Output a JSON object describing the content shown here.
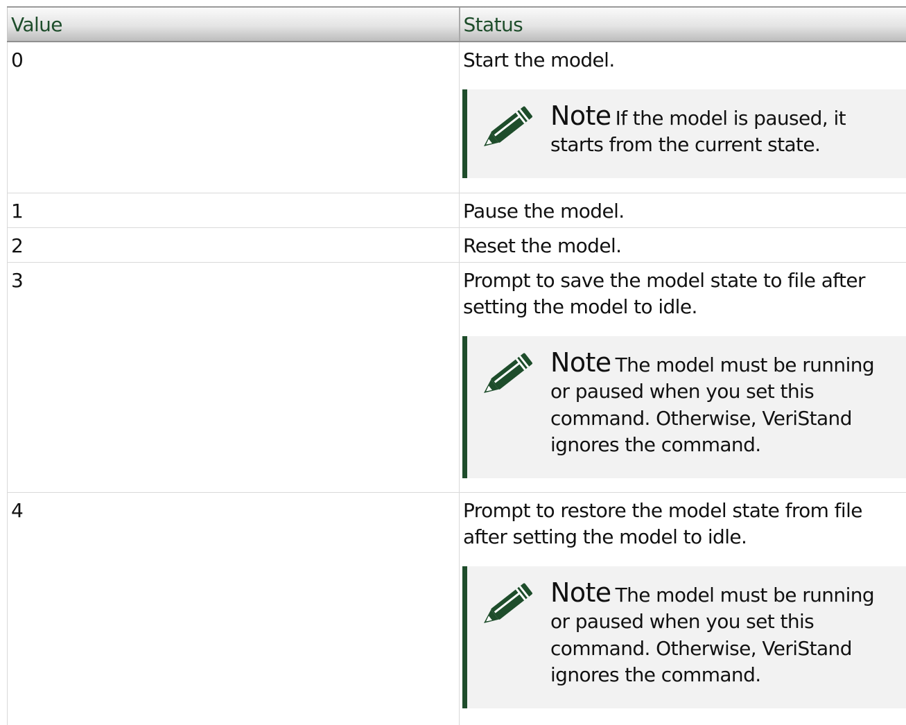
{
  "headers": {
    "value": "Value",
    "status": "Status"
  },
  "rows": [
    {
      "value": "0",
      "status": "Start the model.",
      "note": {
        "label": "Note",
        "text": "If the model is paused, it starts from the current state."
      }
    },
    {
      "value": "1",
      "status": "Pause the model."
    },
    {
      "value": "2",
      "status": "Reset the model."
    },
    {
      "value": "3",
      "status": "Prompt to save the model state to file after setting the model to idle.",
      "note": {
        "label": "Note",
        "text": "The model must be running or paused when you set this command. Otherwise, VeriStand ignores the command."
      }
    },
    {
      "value": "4",
      "status": "Prompt to restore the model state from file after setting the model to idle.",
      "note": {
        "label": "Note",
        "text": "The model must be running or paused when you set this command. Otherwise, VeriStand ignores the command."
      }
    }
  ],
  "colors": {
    "header_text": "#1e4d2b",
    "note_bar": "#1e4d2b",
    "note_bg": "#f2f2f2",
    "icon": "#1e4d2b"
  },
  "icon": "pencil-icon"
}
